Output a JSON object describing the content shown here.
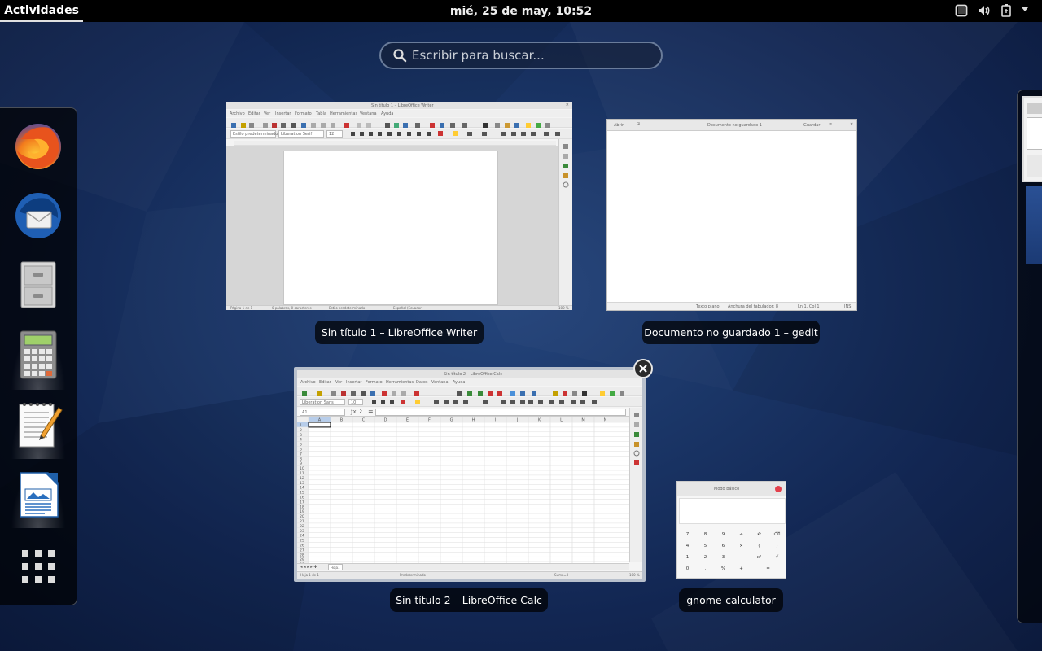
{
  "topbar": {
    "activities": "Actividades",
    "clock": "mié, 25 de may, 10:52"
  },
  "search": {
    "placeholder": "Escribir para buscar..."
  },
  "dash": {
    "items": [
      {
        "name": "Firefox",
        "icon": "firefox-icon"
      },
      {
        "name": "Thunderbird",
        "icon": "thunderbird-icon"
      },
      {
        "name": "Archivos",
        "icon": "file-cabinet-icon"
      },
      {
        "name": "Calculadora",
        "icon": "calculator-icon",
        "running": true
      },
      {
        "name": "gedit",
        "icon": "text-editor-icon",
        "running": true
      },
      {
        "name": "LibreOffice Writer",
        "icon": "writer-icon",
        "running": true
      },
      {
        "name": "Mostrar aplicaciones",
        "icon": "app-grid-icon"
      }
    ]
  },
  "windows": [
    {
      "caption": "Sin título 1 – LibreOffice Writer",
      "title": "Sin título 1 – LibreOffice Writer",
      "menu": [
        "Archivo",
        "Editar",
        "Ver",
        "Insertar",
        "Formato",
        "Tabla",
        "Herramientas",
        "Ventana",
        "Ayuda"
      ],
      "style": "Estilo predeterminado",
      "font": "Liberation Serif",
      "size": "12",
      "status": [
        "Página 1 de 1",
        "0 palabras, 0 caracteres",
        "Estilo predeterminado",
        "Español (Ecuador)",
        "100 %"
      ]
    },
    {
      "caption": "Documento no guardado 1 – gedit",
      "title": "Documento no guardado 1",
      "open": "Abrir",
      "save": "Guardar",
      "status": [
        "Texto plano",
        "Anchura del tabulador: 8",
        "Ln 1, Col 1",
        "INS"
      ]
    },
    {
      "caption": "Sin título 2 – LibreOffice Calc",
      "title": "Sin título 2 – LibreOffice Calc",
      "menu": [
        "Archivo",
        "Editar",
        "Ver",
        "Insertar",
        "Formato",
        "Herramientas",
        "Datos",
        "Ventana",
        "Ayuda"
      ],
      "font": "Liberation Sans",
      "size": "10",
      "cell": "A1",
      "columns": [
        "A",
        "B",
        "C",
        "D",
        "E",
        "F",
        "G",
        "H",
        "I",
        "J",
        "K",
        "L",
        "M",
        "N"
      ],
      "sheet": "Hoja1",
      "status": [
        "Hoja 1 de 1",
        "Predeterminado",
        "Suma=0",
        "100 %"
      ]
    },
    {
      "caption": "gnome-calculator",
      "mode": "Modo básico",
      "keys": [
        [
          "7",
          "8",
          "9",
          "÷",
          "↶",
          "⌫"
        ],
        [
          "4",
          "5",
          "6",
          "×",
          "(",
          ")"
        ],
        [
          "1",
          "2",
          "3",
          "−",
          "x²",
          "√"
        ],
        [
          "0",
          ".",
          "%",
          "+",
          "="
        ]
      ]
    }
  ],
  "colors": {
    "topbar": "#000000",
    "accent": "#4a90d9",
    "close": "#e3404c"
  }
}
